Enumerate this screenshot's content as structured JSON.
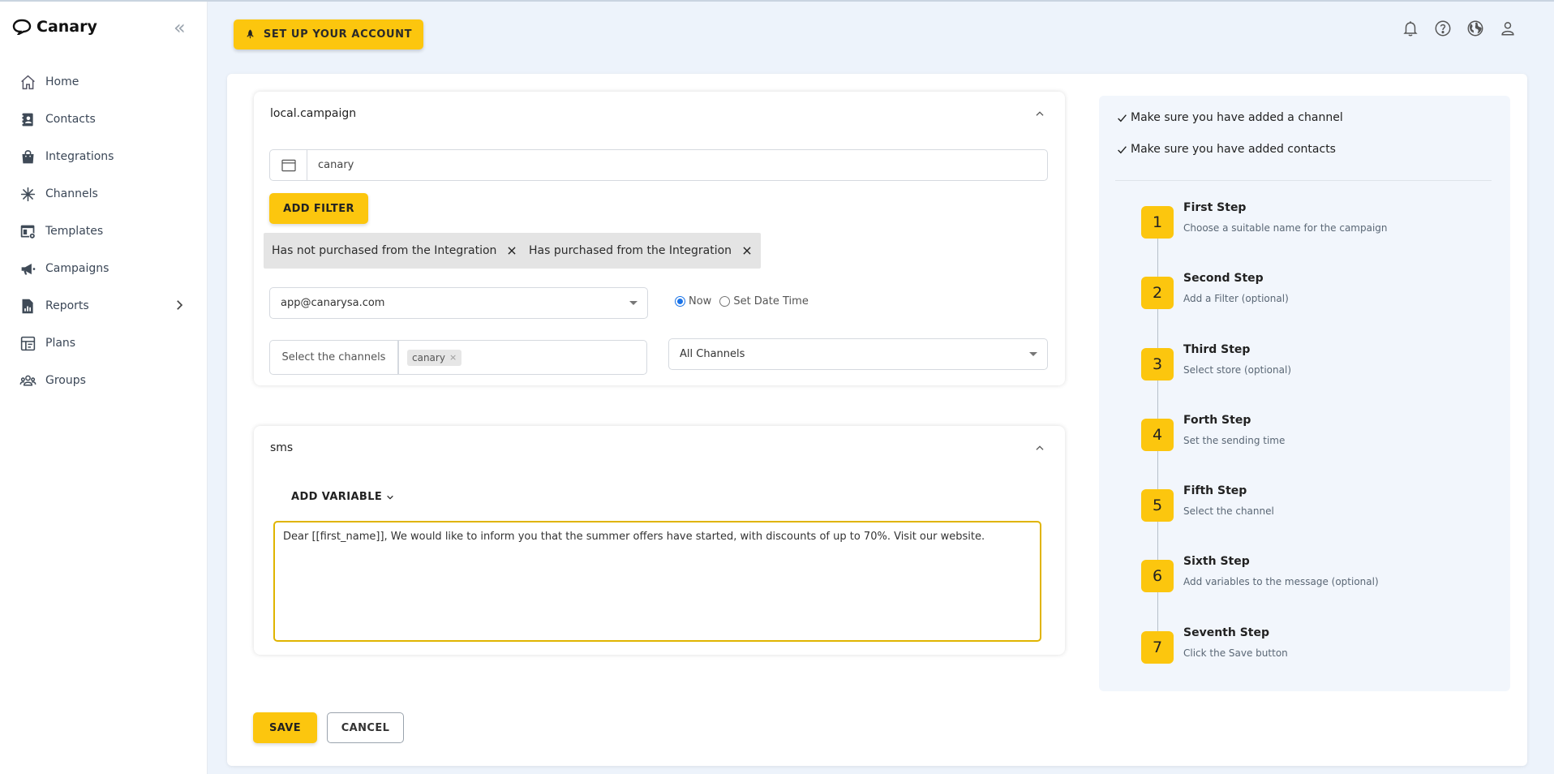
{
  "brand": {
    "name": "Canary"
  },
  "sidebar": {
    "items": [
      {
        "label": "Home",
        "icon": "home-icon"
      },
      {
        "label": "Contacts",
        "icon": "contacts-icon"
      },
      {
        "label": "Integrations",
        "icon": "shopping-bag-icon"
      },
      {
        "label": "Channels",
        "icon": "asterisk-icon"
      },
      {
        "label": "Templates",
        "icon": "template-icon"
      },
      {
        "label": "Campaigns",
        "icon": "megaphone-icon"
      },
      {
        "label": "Reports",
        "icon": "report-icon"
      },
      {
        "label": "Plans",
        "icon": "plans-icon"
      },
      {
        "label": "Groups",
        "icon": "groups-icon"
      }
    ]
  },
  "header": {
    "setup_label": "SET UP YOUR ACCOUNT",
    "icons": [
      "bell-icon",
      "help-icon",
      "globe-icon",
      "user-icon"
    ]
  },
  "campaign": {
    "title": "local.campaign",
    "name_value": "canary",
    "add_filter_label": "ADD FILTER",
    "filters": [
      "Has not purchased from the Integration",
      "Has purchased from the Integration"
    ],
    "sender_value": "app@canarysa.com",
    "radio_now": "Now",
    "radio_datetime": "Set Date Time",
    "channels_label": "Select the channels",
    "channel_tag": "canary",
    "all_channels": "All Channels"
  },
  "sms": {
    "title": "sms",
    "add_variable_label": "ADD VARIABLE",
    "message": "Dear [[first_name]], We would like to inform you that the summer offers have started, with discounts of up to 70%. Visit our website."
  },
  "actions": {
    "save": "SAVE",
    "cancel": "CANCEL"
  },
  "helper": {
    "checks": [
      "Make sure you have added a channel",
      "Make sure you have added contacts"
    ],
    "steps": [
      {
        "num": "1",
        "title": "First Step",
        "desc": "Choose a suitable name for the campaign"
      },
      {
        "num": "2",
        "title": "Second Step",
        "desc": "Add a Filter (optional)"
      },
      {
        "num": "3",
        "title": "Third Step",
        "desc": "Select store (optional)"
      },
      {
        "num": "4",
        "title": "Forth Step",
        "desc": "Set the sending time"
      },
      {
        "num": "5",
        "title": "Fifth Step",
        "desc": "Select the channel"
      },
      {
        "num": "6",
        "title": "Sixth Step",
        "desc": "Add variables to the message (optional)"
      },
      {
        "num": "7",
        "title": "Seventh Step",
        "desc": "Click the Save button"
      }
    ]
  },
  "colors": {
    "accent": "#fcc60e",
    "background": "#edf3fb",
    "helper_bg": "#f2f6fc",
    "radio": "#1a73e8"
  }
}
